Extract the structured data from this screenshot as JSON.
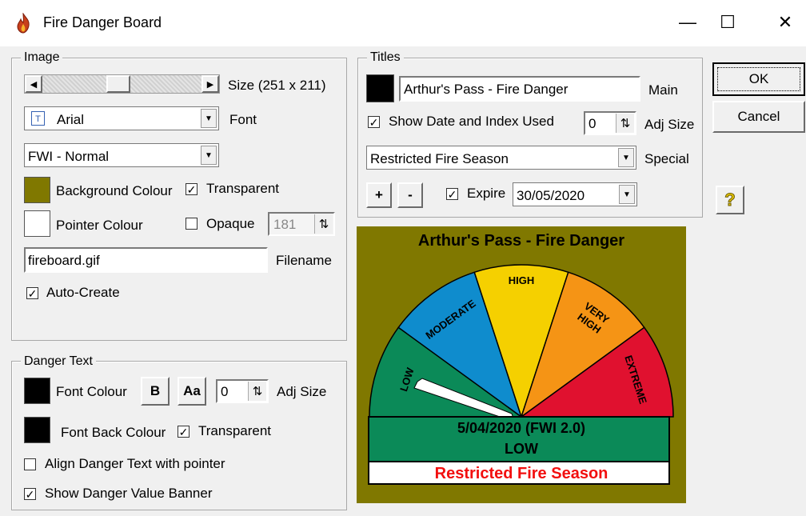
{
  "window": {
    "title": "Fire Danger Board",
    "minimize": "—",
    "maximize": "☐",
    "close": "✕"
  },
  "image_group": {
    "legend": "Image",
    "size_label": "Size (251 x 211)",
    "scroll_fraction": 0.47,
    "font_value": "Arial",
    "font_label": "Font",
    "scheme_value": "FWI - Normal",
    "background_colour_label": "Background Colour",
    "background_colour": "#807800",
    "transparent_label": "Transparent",
    "transparent_checked": "✓",
    "pointer_colour_label": "Pointer Colour",
    "pointer_colour": "#ffffff",
    "opaque_label": "Opaque",
    "opaque_value": "181",
    "filename_value": "fireboard.gif",
    "filename_label": "Filename",
    "auto_create_label": "Auto-Create",
    "auto_create_checked": "✓"
  },
  "danger_text_group": {
    "legend": "Danger Text",
    "font_colour_label": "Font Colour",
    "bold_label": "B",
    "case_label": "Aa",
    "adj_value": "0",
    "adj_size_label": "Adj Size",
    "font_back_colour_label": "Font Back Colour",
    "transparent_label": "Transparent",
    "transparent_checked": "✓",
    "align_label": "Align Danger Text with pointer",
    "show_banner_label": "Show Danger Value Banner",
    "show_banner_checked": "✓"
  },
  "titles_group": {
    "legend": "Titles",
    "main_value": "Arthur's Pass - Fire Danger",
    "main_label": "Main",
    "show_date_label": "Show Date and Index Used",
    "show_date_checked": "✓",
    "adj_value": "0",
    "adj_size_label": "Adj Size",
    "special_value": "Restricted Fire Season",
    "special_label": "Special",
    "plus_label": "+",
    "minus_label": "-",
    "expire_label": "Expire",
    "expire_checked": "✓",
    "expire_date": "30/05/2020"
  },
  "buttons": {
    "ok": "OK",
    "cancel": "Cancel",
    "help": "?"
  },
  "board": {
    "title": "Arthur's Pass - Fire Danger",
    "background": "#807800",
    "segments": [
      {
        "label": "LOW",
        "color": "#0b8a58"
      },
      {
        "label": "MODERATE",
        "color": "#0f8ccd"
      },
      {
        "label": "HIGH",
        "color": "#f5d000"
      },
      {
        "label": "VERY HIGH",
        "color": "#f59415"
      },
      {
        "label": "EXTREME",
        "color": "#e0112f"
      }
    ],
    "info_line1": "5/04/2020 (FWI 2.0)",
    "info_line2": "LOW",
    "banner": "Restricted Fire Season",
    "banner_color": "#f20f0f"
  }
}
